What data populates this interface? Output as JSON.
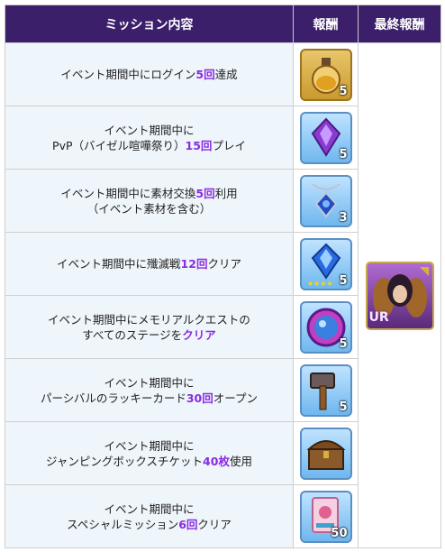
{
  "header": {
    "mission_col": "ミッション内容",
    "reward_col": "報酬",
    "final_col": "最終報酬"
  },
  "rows": [
    {
      "lines": [
        [
          "イベント期間中にログイン",
          ""
        ],
        [
          "5回",
          "hl"
        ],
        [
          "達成",
          ""
        ]
      ],
      "count": "5",
      "icon": "potion-icon"
    },
    {
      "line1": "イベント期間中に",
      "pre": "PvP（バイゼル喧嘩祭り）",
      "hl": "15回",
      "post": "プレイ",
      "count": "5",
      "icon": "purple-gem-icon"
    },
    {
      "pre": "イベント期間中に素材交換",
      "hl": "5回",
      "post": "利用",
      "line2": "（イベント素材を含む）",
      "count": "3",
      "icon": "pendant-icon"
    },
    {
      "pre": "イベント期間中に殲滅戦",
      "hl": "12回",
      "post": "クリア",
      "count": "5",
      "icon": "blue-crystal-icon"
    },
    {
      "line1": "イベント期間中にメモリアルクエストの",
      "pre": "すべてのステージを",
      "hl": "クリア",
      "post": "",
      "count": "5",
      "icon": "orb-icon"
    },
    {
      "line1": "イベント期間中に",
      "pre": "パーシバルのラッキーカード",
      "hl": "30回",
      "post": "オープン",
      "count": "5",
      "icon": "hammer-icon"
    },
    {
      "line1": "イベント期間中に",
      "pre": "ジャンピングボックスチケット",
      "hl": "40枚",
      "post": "使用",
      "count": "",
      "icon": "treasure-chest-icon"
    },
    {
      "line1": "イベント期間中に",
      "pre": "スペシャルミッション",
      "hl": "6回",
      "post": "クリア",
      "count": "50",
      "icon": "ticket-icon"
    }
  ],
  "final_reward": {
    "badge": "UR",
    "icon": "character-card-icon"
  }
}
